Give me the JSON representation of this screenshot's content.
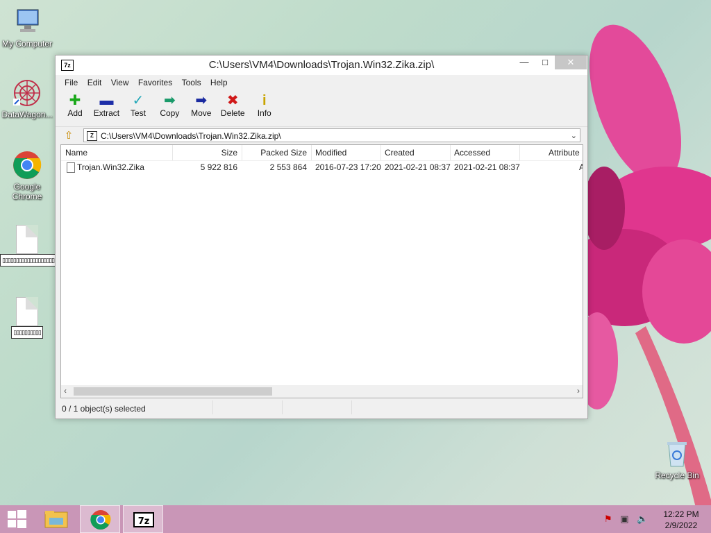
{
  "desktop": {
    "icons": [
      {
        "label": "My Computer"
      },
      {
        "label": "DataWagon..."
      },
      {
        "label": "Google Chrome"
      },
      {
        "label": "▯▯▯▯▯▯▯▯▯▯▯▯▯▯▯▯▯▯▯▯"
      },
      {
        "label": "▯▯▯▯▯▯▯▯▯▯"
      },
      {
        "label": "Recycle Bin"
      }
    ]
  },
  "window": {
    "title": "C:\\Users\\VM4\\Downloads\\Trojan.Win32.Zika.zip\\",
    "logo_text": "7z",
    "controls": {
      "minimize": "—",
      "maximize": "□",
      "close": "✕"
    },
    "menu": [
      "File",
      "Edit",
      "View",
      "Favorites",
      "Tools",
      "Help"
    ],
    "toolbar": [
      {
        "label": "Add",
        "icon": "add-icon"
      },
      {
        "label": "Extract",
        "icon": "extract-icon"
      },
      {
        "label": "Test",
        "icon": "test-icon"
      },
      {
        "label": "Copy",
        "icon": "copy-icon"
      },
      {
        "label": "Move",
        "icon": "move-icon"
      },
      {
        "label": "Delete",
        "icon": "delete-icon"
      },
      {
        "label": "Info",
        "icon": "info-icon"
      }
    ],
    "address": "C:\\Users\\VM4\\Downloads\\Trojan.Win32.Zika.zip\\",
    "columns": [
      "Name",
      "Size",
      "Packed Size",
      "Modified",
      "Created",
      "Accessed",
      "Attribute"
    ],
    "rows": [
      {
        "name": "Trojan.Win32.Zika",
        "size": "5 922 816",
        "packed": "2 553 864",
        "modified": "2016-07-23 17:20",
        "created": "2021-02-21 08:37",
        "accessed": "2021-02-21 08:37",
        "attr": "A"
      }
    ],
    "status": "0 / 1 object(s) selected"
  },
  "taskbar": {
    "time": "12:22 PM",
    "date": "2/9/2022",
    "apps": [
      "start",
      "file-explorer",
      "google-chrome",
      "7-zip"
    ]
  }
}
